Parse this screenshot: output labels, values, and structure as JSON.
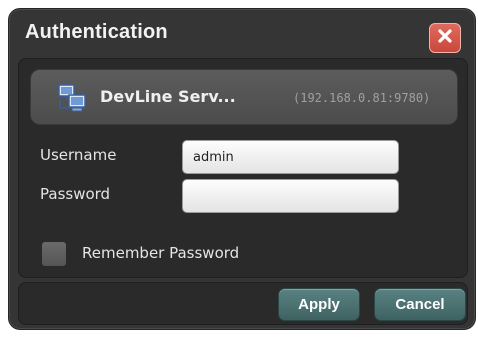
{
  "dialog": {
    "title": "Authentication",
    "close_icon": "close-icon",
    "accent_close": "#d4574b",
    "accent_button": "#4c7272"
  },
  "server": {
    "icon": "network-computers-icon",
    "name": "DevLine Serv...",
    "address": "(192.168.0.81:9780)"
  },
  "form": {
    "username_label": "Username",
    "username_value": "admin",
    "password_label": "Password",
    "password_value": "",
    "remember_label": "Remember Password",
    "remember_checked": false
  },
  "buttons": {
    "apply_label": "Apply",
    "cancel_label": "Cancel"
  }
}
